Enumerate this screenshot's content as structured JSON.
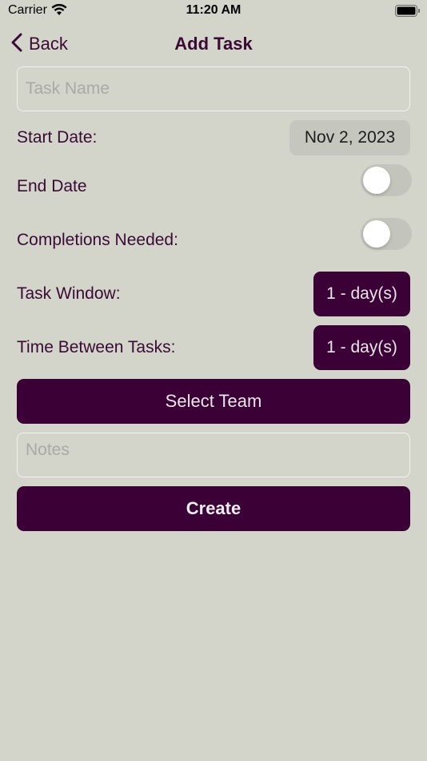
{
  "status_bar": {
    "carrier": "Carrier",
    "time": "11:20 AM"
  },
  "nav": {
    "back_label": "Back",
    "title": "Add Task"
  },
  "form": {
    "task_name_placeholder": "Task Name",
    "start_date_label": "Start Date:",
    "start_date_value": "Nov 2, 2023",
    "end_date_label": "End Date",
    "end_date_enabled": false,
    "completions_label": "Completions Needed:",
    "completions_enabled": false,
    "task_window_label": "Task Window:",
    "task_window_value": "1 - day(s)",
    "time_between_label": "Time Between Tasks:",
    "time_between_value": "1 - day(s)",
    "select_team_label": "Select Team",
    "notes_placeholder": "Notes",
    "create_label": "Create"
  },
  "colors": {
    "background": "#d3d5cb",
    "accent": "#3b0035",
    "text": "#3a0a35"
  }
}
